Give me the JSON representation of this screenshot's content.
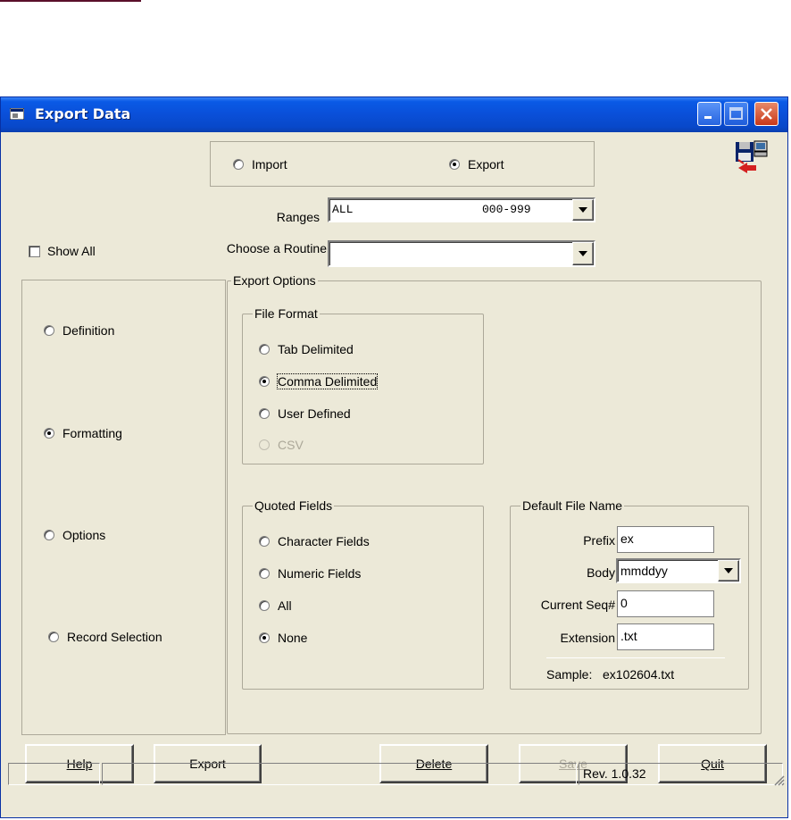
{
  "window": {
    "title": "Export Data"
  },
  "mode": {
    "import_label": "Import",
    "export_label": "Export",
    "selected": "export"
  },
  "ranges": {
    "label": "Ranges",
    "value_name": "ALL",
    "value_range": "000-999"
  },
  "routine": {
    "label": "Choose a Routine",
    "value": ""
  },
  "show_all": {
    "label": "Show All",
    "checked": false
  },
  "nav": {
    "items": [
      {
        "label": "Definition",
        "selected": false
      },
      {
        "label": "Formatting",
        "selected": true
      },
      {
        "label": "Options",
        "selected": false
      },
      {
        "label": "Record Selection",
        "selected": false
      }
    ]
  },
  "export_options": {
    "title": "Export Options",
    "file_format": {
      "title": "File Format",
      "options": [
        {
          "label": "Tab Delimited",
          "selected": false,
          "enabled": true
        },
        {
          "label": "Comma Delimited",
          "selected": true,
          "enabled": true
        },
        {
          "label": "User Defined",
          "selected": false,
          "enabled": true
        },
        {
          "label": "CSV",
          "selected": false,
          "enabled": false
        }
      ]
    },
    "quoted_fields": {
      "title": "Quoted Fields",
      "options": [
        {
          "label": "Character Fields",
          "selected": false
        },
        {
          "label": "Numeric Fields",
          "selected": false
        },
        {
          "label": "All",
          "selected": false
        },
        {
          "label": "None",
          "selected": true
        }
      ]
    },
    "default_file_name": {
      "title": "Default File Name",
      "prefix_label": "Prefix",
      "prefix_value": "ex",
      "body_label": "Body",
      "body_value": "mmddyy",
      "seq_label": "Current Seq#",
      "seq_value": "0",
      "ext_label": "Extension",
      "ext_value": ".txt",
      "sample_label": "Sample:",
      "sample_value": "ex102604.txt"
    }
  },
  "buttons": {
    "help": "Help",
    "export": "Export",
    "delete": "Delete",
    "save": "Save",
    "quit": "Quit"
  },
  "status": {
    "revision": "Rev. 1.0.32"
  },
  "colors": {
    "titlebar": "#0a4fd8",
    "window_bg": "#ece9d8",
    "group_border": "#aca899",
    "disabled_text": "#aca899"
  }
}
